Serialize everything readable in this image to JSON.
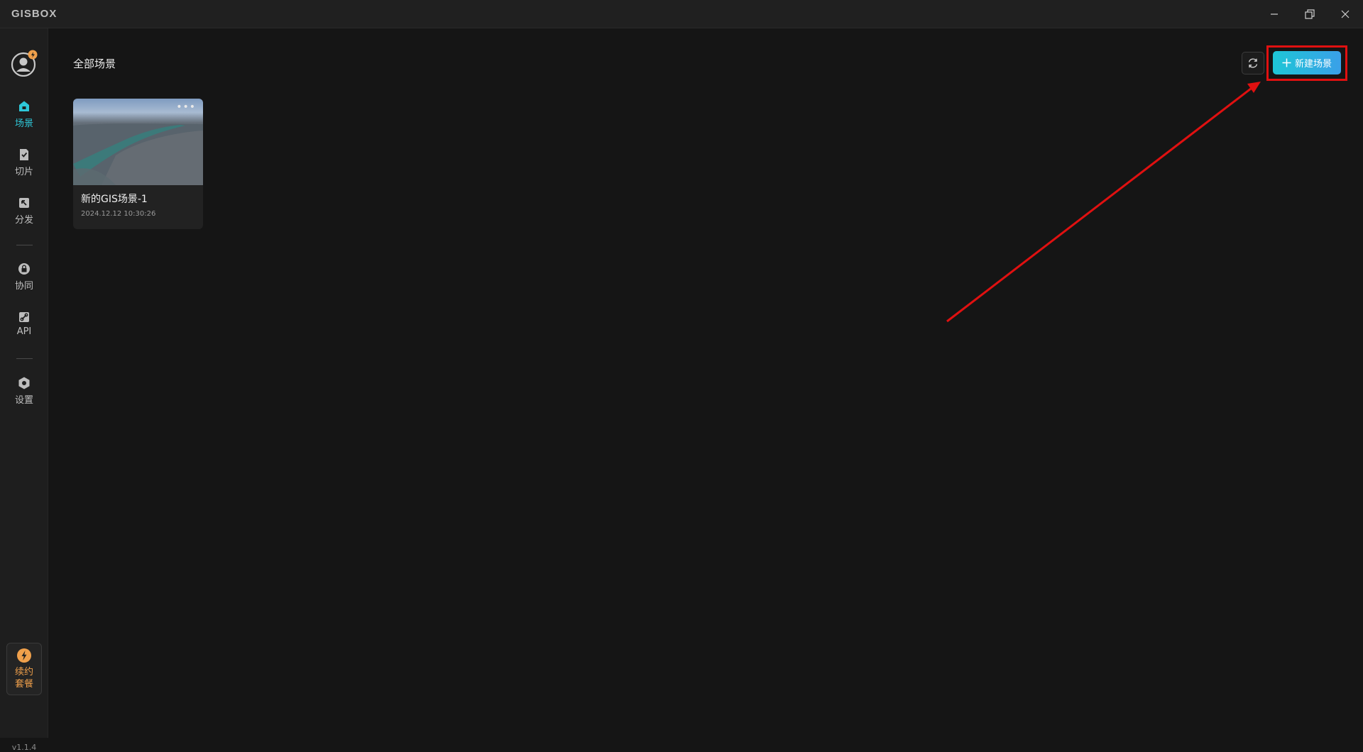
{
  "app": {
    "logo": "GISBOX"
  },
  "window_controls": {
    "minimize": "minimize",
    "restore": "restore",
    "close": "close"
  },
  "sidebar": {
    "items": [
      {
        "label": "场景",
        "icon": "home-icon",
        "active": true
      },
      {
        "label": "切片",
        "icon": "document-check-icon",
        "active": false
      },
      {
        "label": "分发",
        "icon": "share-icon",
        "active": false
      },
      {
        "label": "协同",
        "icon": "lock-icon",
        "active": false
      },
      {
        "label": "API",
        "icon": "link-icon",
        "active": false
      },
      {
        "label": "设置",
        "icon": "settings-hex-icon",
        "active": false
      }
    ],
    "renew": {
      "label": "续约套餐",
      "icon": "lightning-icon"
    },
    "version": "v1.1.4"
  },
  "main": {
    "title": "全部场景",
    "new_button_label": "新建场景",
    "refresh_icon": "refresh-icon",
    "scenes": [
      {
        "name": "新的GIS场景-1",
        "date": "2024.12.12 10:30:26",
        "more": "•••"
      }
    ]
  },
  "annotation": {
    "highlight_color": "#e01010",
    "target": "新建场景"
  },
  "colors": {
    "accent": "#2ec7d8",
    "background": "#151515",
    "sidebar": "#1e1e1e"
  }
}
